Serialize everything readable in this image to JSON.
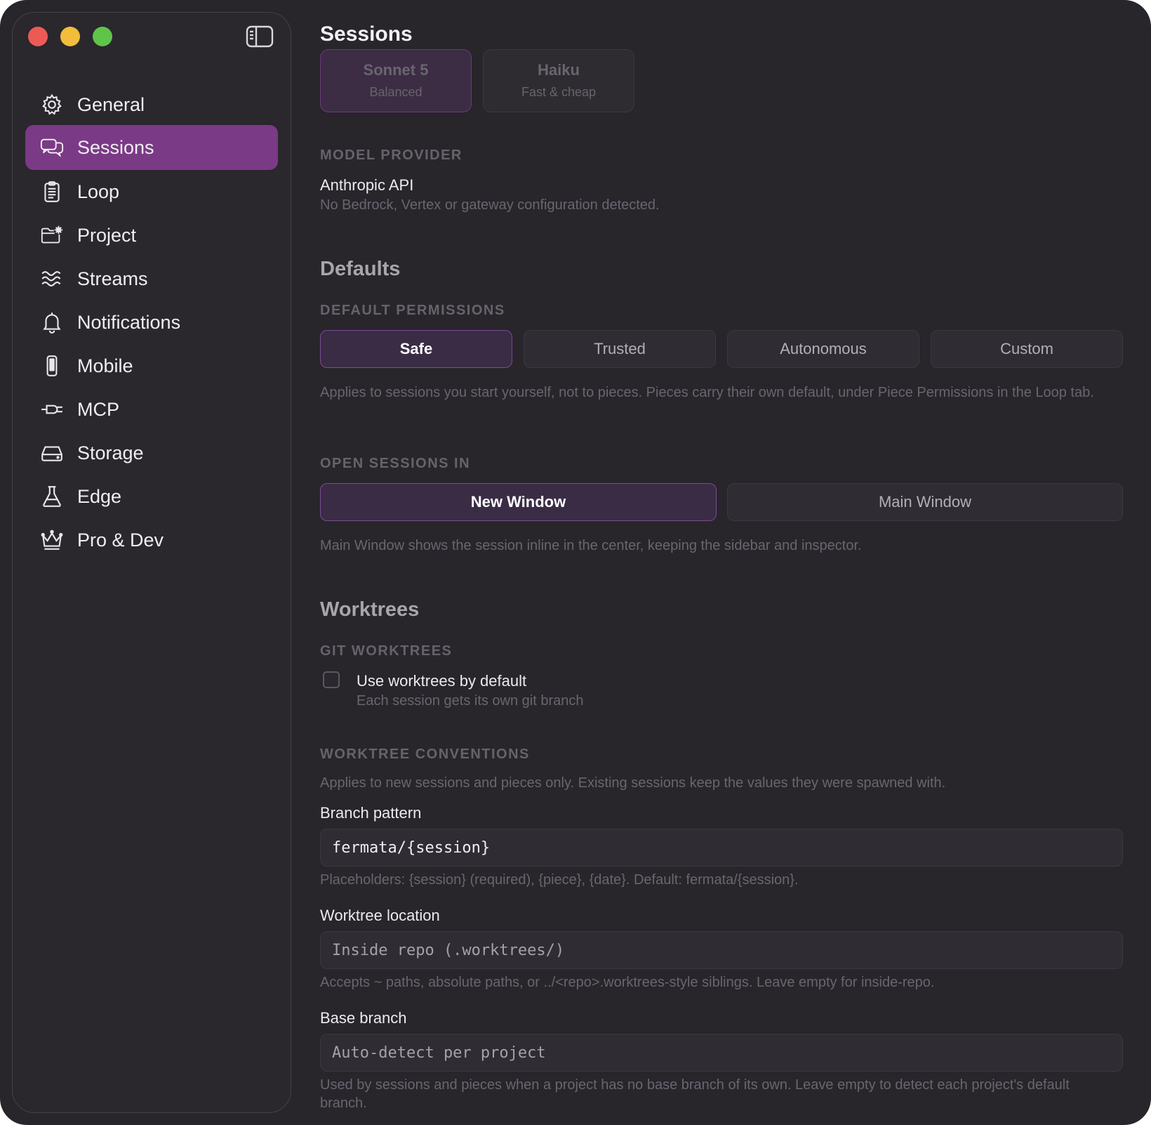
{
  "sidebar": {
    "items": [
      {
        "label": "General",
        "icon": "gear-icon"
      },
      {
        "label": "Sessions",
        "icon": "chat-bubbles-icon",
        "active": true
      },
      {
        "label": "Loop",
        "icon": "clipboard-icon"
      },
      {
        "label": "Project",
        "icon": "folder-gear-icon"
      },
      {
        "label": "Streams",
        "icon": "waves-icon"
      },
      {
        "label": "Notifications",
        "icon": "bell-icon"
      },
      {
        "label": "Mobile",
        "icon": "phone-icon"
      },
      {
        "label": "MCP",
        "icon": "plug-icon"
      },
      {
        "label": "Storage",
        "icon": "drive-icon"
      },
      {
        "label": "Edge",
        "icon": "flask-icon"
      },
      {
        "label": "Pro & Dev",
        "icon": "crown-icon"
      }
    ],
    "accent": "#7b3a86"
  },
  "main": {
    "title": "Sessions",
    "models": [
      {
        "name": "Sonnet 5",
        "desc": "Balanced",
        "selected": true
      },
      {
        "name": "Haiku",
        "desc": "Fast & cheap",
        "selected": false
      }
    ],
    "model_provider": {
      "label": "MODEL PROVIDER",
      "value": "Anthropic API",
      "note": "No Bedrock, Vertex or gateway configuration detected."
    },
    "defaults": {
      "heading": "Defaults",
      "permissions_label": "DEFAULT PERMISSIONS",
      "permissions": [
        "Safe",
        "Trusted",
        "Autonomous",
        "Custom"
      ],
      "permissions_selected": "Safe",
      "permissions_note": "Applies to sessions you start yourself, not to pieces. Pieces carry their own default, under Piece Permissions in the Loop tab.",
      "open_in_label": "OPEN SESSIONS IN",
      "open_in": [
        "New Window",
        "Main Window"
      ],
      "open_in_selected": "New Window",
      "open_in_note": "Main Window shows the session inline in the center, keeping the sidebar and inspector."
    },
    "worktrees": {
      "heading": "Worktrees",
      "git_label": "GIT WORKTREES",
      "use_default_label": "Use worktrees by default",
      "use_default_checked": false,
      "use_default_note": "Each session gets its own git branch",
      "conventions_label": "WORKTREE CONVENTIONS",
      "conventions_note": "Applies to new sessions and pieces only. Existing sessions keep the values they were spawned with.",
      "branch_pattern": {
        "label": "Branch pattern",
        "value": "fermata/{session}",
        "note": "Placeholders: {session} (required), {piece}, {date}. Default: fermata/{session}."
      },
      "location": {
        "label": "Worktree location",
        "placeholder": "Inside repo (.worktrees/)",
        "note": "Accepts ~ paths, absolute paths, or ../<repo>.worktrees-style siblings. Leave empty for inside-repo."
      },
      "base_branch": {
        "label": "Base branch",
        "placeholder": "Auto-detect per project",
        "note": "Used by sessions and pieces when a project has no base branch of its own. Leave empty to detect each project's default branch."
      }
    }
  }
}
